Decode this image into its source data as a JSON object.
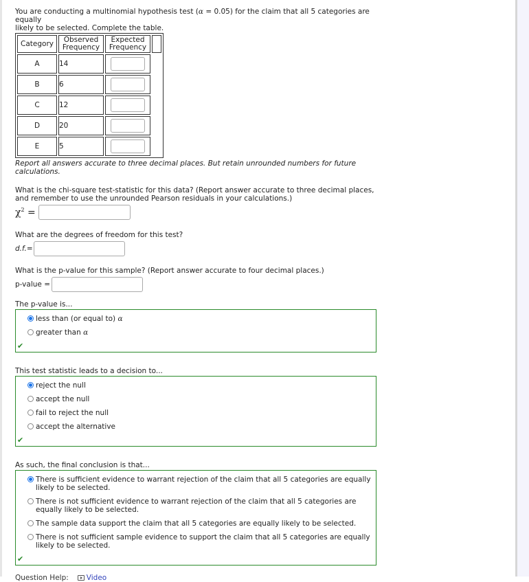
{
  "intro": {
    "line1": "You are conducting a multinomial hypothesis test (",
    "alpha_symbol": "α",
    "line1_rest": " = 0.05) for the claim that all 5 categories are equally",
    "line2": "likely to be selected. Complete the table."
  },
  "table": {
    "headers": {
      "category": "Category",
      "observed_1": "Observed",
      "observed_2": "Frequency",
      "expected_1": "Expected",
      "expected_2": "Frequency"
    },
    "rows": [
      {
        "category": "A",
        "observed": "14",
        "expected": ""
      },
      {
        "category": "B",
        "observed": "6",
        "expected": ""
      },
      {
        "category": "C",
        "observed": "12",
        "expected": ""
      },
      {
        "category": "D",
        "observed": "20",
        "expected": ""
      },
      {
        "category": "E",
        "observed": "5",
        "expected": ""
      }
    ]
  },
  "note": "Report all answers accurate to three decimal places. But retain unrounded numbers for future calculations.",
  "chi_question": {
    "text": "What is the chi-square test-statistic for this data? (Report answer accurate to three decimal places, and remember to use the unrounded Pearson residuals in your calculations.)",
    "symbol": "χ",
    "sup": "2",
    "equals": "=",
    "value": ""
  },
  "df_question": {
    "text": "What are the degrees of freedom for this test?",
    "label": "d.f.=",
    "value": ""
  },
  "p_question": {
    "text": "What is the p-value for this sample? (Report answer accurate to four decimal places.)",
    "label": "p-value =",
    "value": ""
  },
  "pvalue_compare": {
    "label": "The p-value is...",
    "options": [
      {
        "text": "less than (or equal to) ",
        "alpha": "α",
        "selected": true
      },
      {
        "text": "greater than ",
        "alpha": "α",
        "selected": false
      }
    ],
    "status": "✔"
  },
  "decision": {
    "label": "This test statistic leads to a decision to...",
    "options": [
      {
        "text": "reject the null",
        "selected": true
      },
      {
        "text": "accept the null",
        "selected": false
      },
      {
        "text": "fail to reject the null",
        "selected": false
      },
      {
        "text": "accept the alternative",
        "selected": false
      }
    ],
    "status": "✔"
  },
  "conclusion": {
    "label": "As such, the final conclusion is that...",
    "options": [
      {
        "text": "There is sufficient evidence to warrant rejection of the claim that all 5 categories are equally likely to be selected.",
        "selected": true
      },
      {
        "text": "There is not sufficient evidence to warrant rejection of the claim that all 5 categories are equally likely to be selected.",
        "selected": false
      },
      {
        "text": "The sample data support the claim that all 5 categories are equally likely to be selected.",
        "selected": false
      },
      {
        "text": "There is not sufficient sample evidence to support the claim that all 5 categories are equally likely to be selected.",
        "selected": false
      }
    ],
    "status": "✔"
  },
  "help": {
    "label": "Question Help:",
    "video": "Video"
  },
  "colors": {
    "correct_border": "#2a8a2a",
    "radio_selected": "#1a73e8",
    "link": "#3344bb"
  }
}
